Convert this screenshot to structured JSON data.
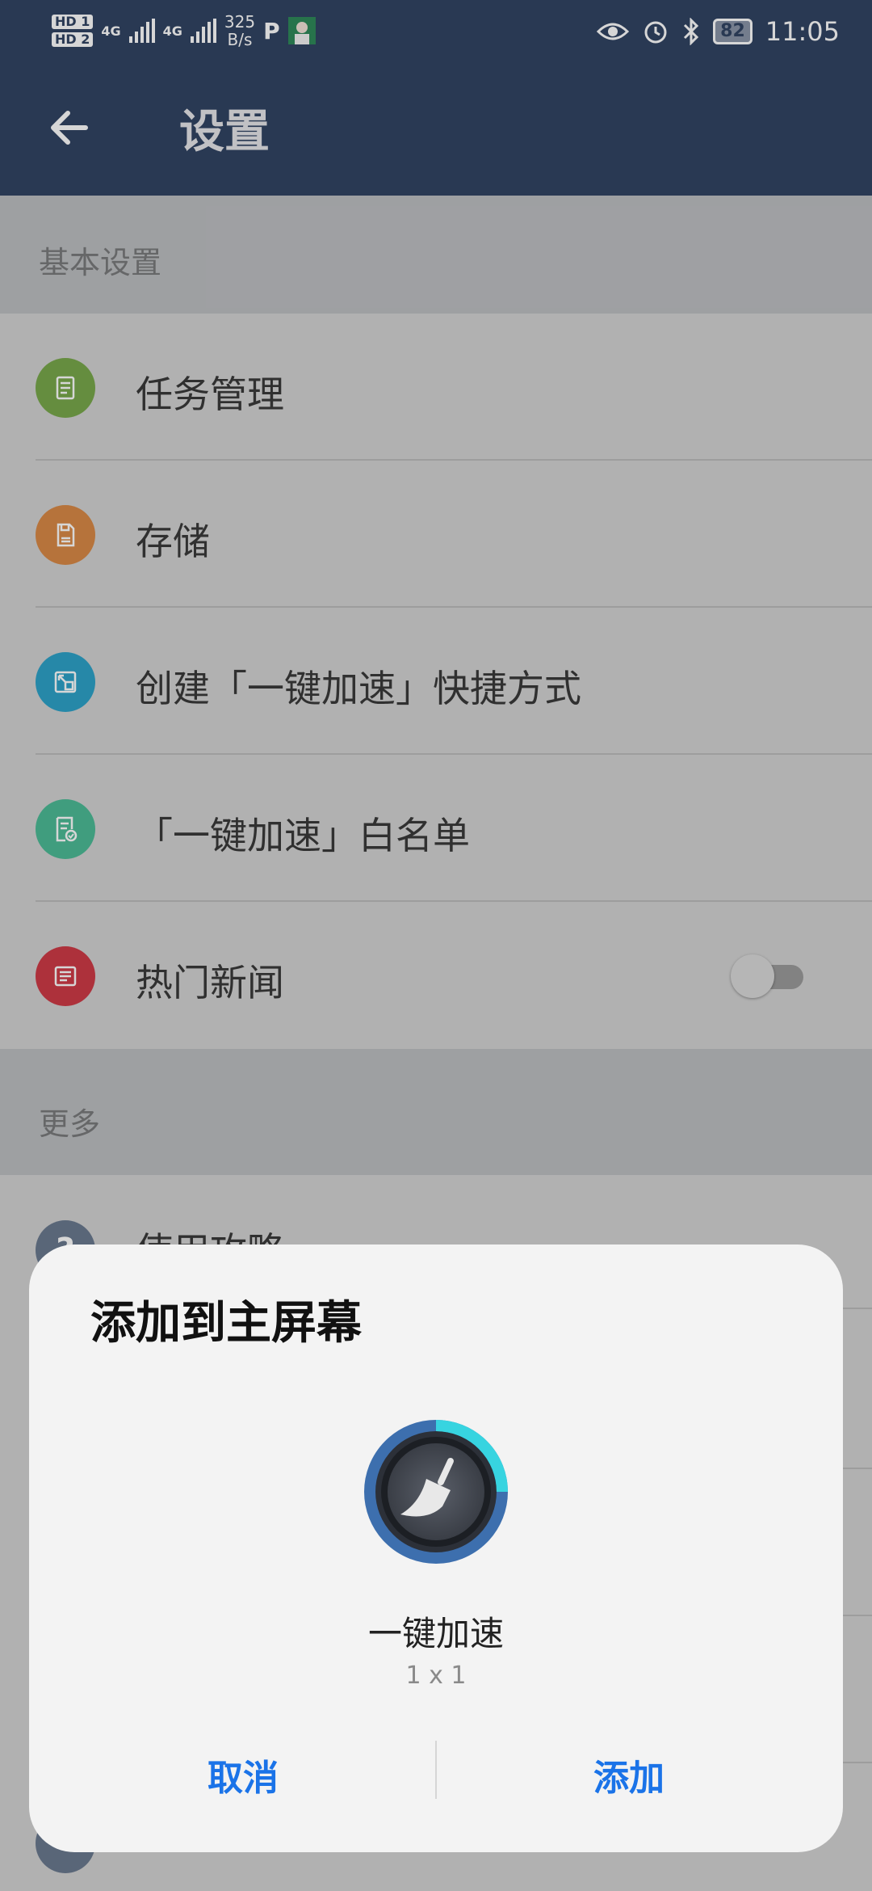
{
  "status_bar": {
    "hd1": "HD 1",
    "hd2": "HD 2",
    "net_type_1": "4G",
    "net_type_2": "4G",
    "speed_value": "325",
    "speed_unit": "B/s",
    "battery": "82",
    "time": "11:05"
  },
  "toolbar": {
    "title": "设置"
  },
  "sections": {
    "basic": {
      "header": "基本设置",
      "items": [
        {
          "label": "任务管理",
          "icon": "task-icon",
          "color": "#79a84c"
        },
        {
          "label": "存储",
          "icon": "storage-icon",
          "color": "#d98a47"
        },
        {
          "label": "创建「一键加速」快捷方式",
          "icon": "shortcut-icon",
          "color": "#2ea3c9"
        },
        {
          "label": "「一键加速」白名单",
          "icon": "whitelist-icon",
          "color": "#4dbb97"
        },
        {
          "label": "热门新闻",
          "icon": "news-icon",
          "color": "#cf3b47",
          "toggle_on": false
        }
      ]
    },
    "more": {
      "header": "更多",
      "first_item": "使用攻略"
    }
  },
  "dialog": {
    "title": "添加到主屏幕",
    "widget_name": "一键加速",
    "widget_size": "1 x 1",
    "cancel": "取消",
    "add": "添加"
  },
  "colors": {
    "toolbar_bg": "#324463",
    "dialog_bg": "#f3f3f3",
    "accent_button": "#1a73e8"
  }
}
